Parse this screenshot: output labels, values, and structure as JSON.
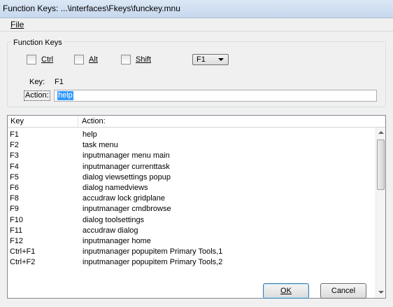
{
  "window": {
    "title": "Function Keys: ...\\interfaces\\Fkeys\\funckey.mnu"
  },
  "menu": {
    "file": "File"
  },
  "group": {
    "label": "Function Keys",
    "ctrl": {
      "label": "Ctrl",
      "checked": false
    },
    "alt": {
      "label": "Alt",
      "checked": false
    },
    "shift": {
      "label": "Shift",
      "checked": false
    },
    "key_select": {
      "selected": "F1"
    },
    "key_label": "Key:",
    "key_value": "F1",
    "action_label": "Action:",
    "action_value": "help"
  },
  "list": {
    "columns": [
      "Key",
      "Action:"
    ],
    "rows": [
      {
        "key": "F1",
        "action": "help"
      },
      {
        "key": "F2",
        "action": "task menu"
      },
      {
        "key": "F3",
        "action": "inputmanager menu main"
      },
      {
        "key": "F4",
        "action": "inputmanager currenttask"
      },
      {
        "key": "F5",
        "action": "dialog viewsettings popup"
      },
      {
        "key": "F6",
        "action": "dialog namedviews"
      },
      {
        "key": "F8",
        "action": "accudraw lock gridplane"
      },
      {
        "key": "F9",
        "action": "inputmanager cmdbrowse"
      },
      {
        "key": "F10",
        "action": "dialog toolsettings"
      },
      {
        "key": "F11",
        "action": "accudraw dialog"
      },
      {
        "key": "F12",
        "action": "inputmanager home"
      },
      {
        "key": "Ctrl+F1",
        "action": "inputmanager popupitem Primary Tools,1"
      },
      {
        "key": "Ctrl+F2",
        "action": "inputmanager popupitem Primary Tools,2"
      }
    ]
  },
  "buttons": {
    "ok": "OK",
    "cancel": "Cancel"
  },
  "colors": {
    "selection": "#3399ff",
    "titlebar": "#c7d8ee"
  }
}
